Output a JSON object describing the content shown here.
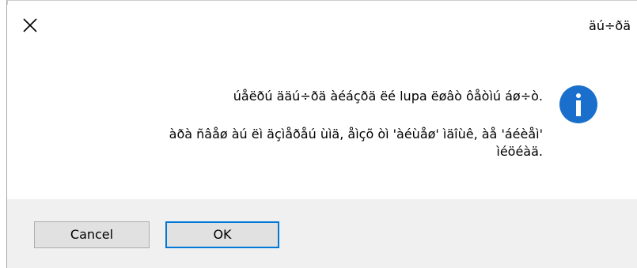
{
  "dialog": {
    "title": "äú÷ðä",
    "close_icon": "close-icon",
    "info_icon": "info-icon",
    "message_line_1": ".úåëðú ääú÷ðä àéáçðä ëé lupa ëøâò ôåòìú áø÷ò",
    "message_line_2": "'àðà ñâåø àú ëì äçìåðåú ùìä, åìçõ òì 'àéùåø' ìäîùê, àå 'áéèåì",
    "message_line_3": ".ìéöéàä",
    "buttons": {
      "cancel_label": "Cancel",
      "ok_label": "OK"
    },
    "colors": {
      "accent": "#0078d7",
      "info_icon": "#1a6fcc",
      "footer_bg": "#f0f0f0",
      "button_bg": "#e1e1e1"
    }
  }
}
